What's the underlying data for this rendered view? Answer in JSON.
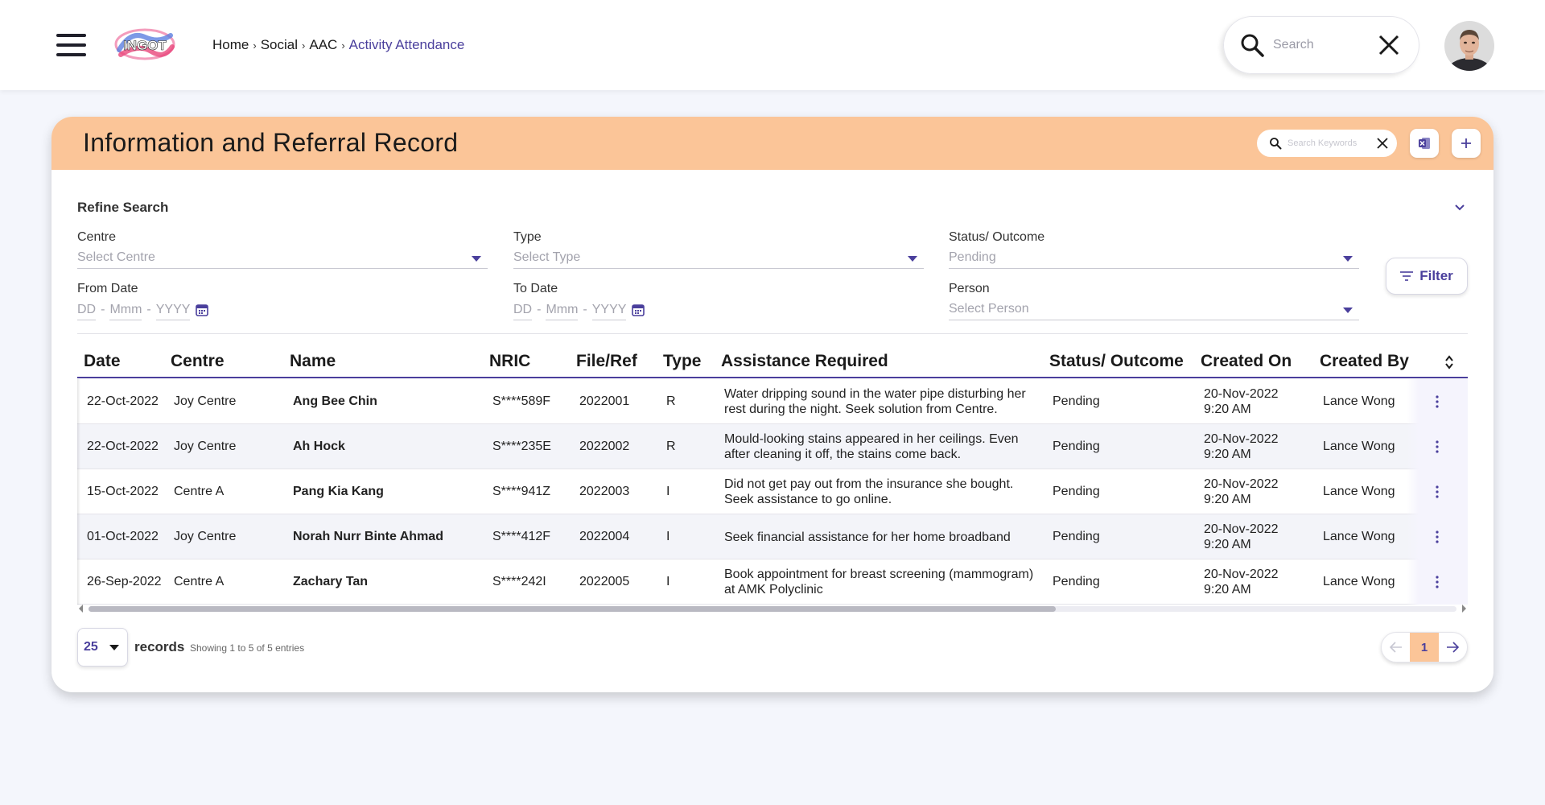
{
  "breadcrumb": {
    "home": "Home",
    "social": "Social",
    "aac": "AAC",
    "current": "Activity Attendance",
    "sep": "›"
  },
  "top_search": {
    "placeholder": "Search"
  },
  "logo": {
    "text": "INGOT"
  },
  "card": {
    "title": "Information and Referral Record",
    "keyword_placeholder": "Search Keywords"
  },
  "refine": {
    "title": "Refine Search",
    "centre": {
      "label": "Centre",
      "value": "Select Centre"
    },
    "type": {
      "label": "Type",
      "value": "Select Type"
    },
    "status": {
      "label": "Status/ Outcome",
      "value": "Pending"
    },
    "from_date": {
      "label": "From Date",
      "dd": "DD",
      "mmm": "Mmm",
      "yyyy": "YYYY",
      "sep": "-"
    },
    "to_date": {
      "label": "To Date",
      "dd": "DD",
      "mmm": "Mmm",
      "yyyy": "YYYY",
      "sep": "-"
    },
    "person": {
      "label": "Person",
      "value": "Select Person"
    },
    "filter_label": "Filter"
  },
  "table": {
    "columns": [
      "Date",
      "Centre",
      "Name",
      "NRIC",
      "File/Ref",
      "Type",
      "Assistance Required",
      "Status/ Outcome",
      "Created On",
      "Created By"
    ],
    "rows": [
      {
        "date": "22-Oct-2022",
        "centre": "Joy Centre",
        "name": "Ang Bee Chin",
        "nric": "S****589F",
        "ref": "2022001",
        "type": "R",
        "assistance": "Water dripping sound in the water pipe disturbing her rest during the night. Seek solution from Centre.",
        "status": "Pending",
        "created_date": "20-Nov-2022",
        "created_time": "9:20 AM",
        "created_by": "Lance Wong"
      },
      {
        "date": "22-Oct-2022",
        "centre": "Joy Centre",
        "name": "Ah Hock",
        "nric": "S****235E",
        "ref": "2022002",
        "type": "R",
        "assistance": "Mould-looking stains appeared in her ceilings. Even after cleaning it off, the stains come back.",
        "status": "Pending",
        "created_date": "20-Nov-2022",
        "created_time": "9:20 AM",
        "created_by": "Lance Wong"
      },
      {
        "date": "15-Oct-2022",
        "centre": "Centre A",
        "name": "Pang Kia Kang",
        "nric": "S****941Z",
        "ref": "2022003",
        "type": "I",
        "assistance": "Did not get pay out from the insurance she bought. Seek assistance to go online.",
        "status": "Pending",
        "created_date": "20-Nov-2022",
        "created_time": "9:20 AM",
        "created_by": "Lance Wong"
      },
      {
        "date": "01-Oct-2022",
        "centre": "Joy Centre",
        "name": "Norah Nurr Binte Ahmad",
        "nric": "S****412F",
        "ref": "2022004",
        "type": "I",
        "assistance": "Seek financial assistance for her home broadband",
        "status": "Pending",
        "created_date": "20-Nov-2022",
        "created_time": "9:20 AM",
        "created_by": "Lance Wong"
      },
      {
        "date": "26-Sep-2022",
        "centre": "Centre A",
        "name": "Zachary Tan",
        "nric": "S****242I",
        "ref": "2022005",
        "type": "I",
        "assistance": "Book appointment for breast screening (mammogram) at AMK Polyclinic",
        "status": "Pending",
        "created_date": "20-Nov-2022",
        "created_time": "9:20 AM",
        "created_by": "Lance Wong"
      }
    ]
  },
  "footer": {
    "page_size": "25",
    "records_label": "records",
    "showing": "Showing 1 to 5 of 5 entries",
    "current_page": "1"
  },
  "colors": {
    "accent": "#4a3f9c",
    "header_bg": "#fbc598",
    "page_bg": "#f4f6fc"
  },
  "icons": [
    "menu-icon",
    "search-icon",
    "close-icon",
    "excel-icon",
    "plus-icon",
    "chevron-down-icon",
    "calendar-icon",
    "filter-icon",
    "sort-icon",
    "kebab-icon",
    "arrow-left-icon",
    "arrow-right-icon"
  ]
}
